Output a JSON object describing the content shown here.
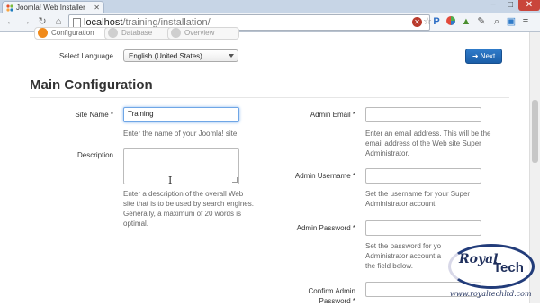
{
  "browser": {
    "tab_title": "Joomla! Web Installer",
    "url_host": "localhost",
    "url_path": "/training/installation/",
    "window_controls": [
      "−",
      "□",
      "✕"
    ]
  },
  "installer": {
    "steps": [
      "Configuration",
      "Database",
      "Overview"
    ],
    "language_label": "Select Language",
    "language_value": "English (United States)",
    "next_label": "➜ Next",
    "heading": "Main Configuration"
  },
  "form": {
    "site_name": {
      "label": "Site Name *",
      "value": "Training",
      "help": "Enter the name of your Joomla! site."
    },
    "description": {
      "label": "Description",
      "help": [
        "Enter a description of the overall Web",
        "site that is to be used by search engines.",
        "Generally, a maximum of 20 words is",
        "optimal."
      ]
    },
    "admin_email": {
      "label": "Admin Email *",
      "help": [
        "Enter an email address. This will be the",
        "email address of the Web site Super",
        "Administrator."
      ]
    },
    "admin_username": {
      "label": "Admin Username *",
      "help": [
        "Set the username for your Super",
        "Administrator account."
      ]
    },
    "admin_password": {
      "label": "Admin Password *",
      "help": [
        "Set the password for yo",
        "Administrator account a",
        "the field below."
      ]
    },
    "confirm_password": {
      "label": [
        "Confirm Admin",
        "Password *"
      ]
    }
  },
  "watermark": {
    "brand_1": "Royal",
    "brand_2": "Tech",
    "site": "www.royaltechltd.com"
  },
  "colors": {
    "primary_button": "#1b5ea8",
    "active_step": "#f08a1a",
    "focus_border": "#6fa6e6"
  }
}
